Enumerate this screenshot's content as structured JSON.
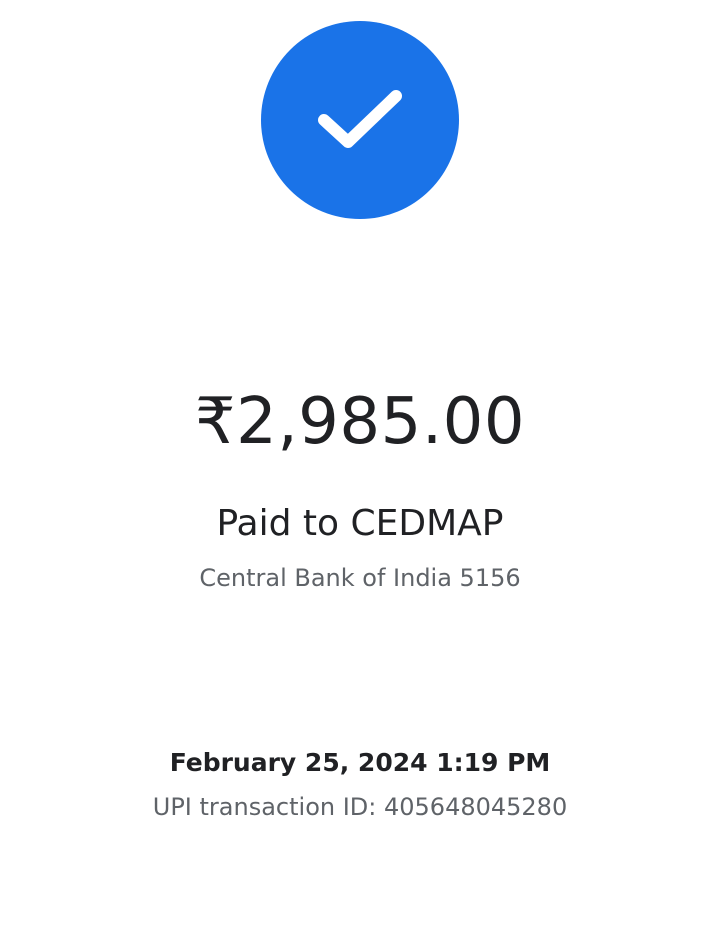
{
  "status": {
    "icon": "check-icon",
    "accent_color": "#1a73e8"
  },
  "payment": {
    "amount": "₹2,985.00",
    "payee_line": "Paid to CEDMAP",
    "bank_line": "Central Bank of India 5156"
  },
  "details": {
    "datetime": "February 25, 2024 1:19 PM",
    "transaction_id": "UPI transaction ID: 405648045280"
  }
}
